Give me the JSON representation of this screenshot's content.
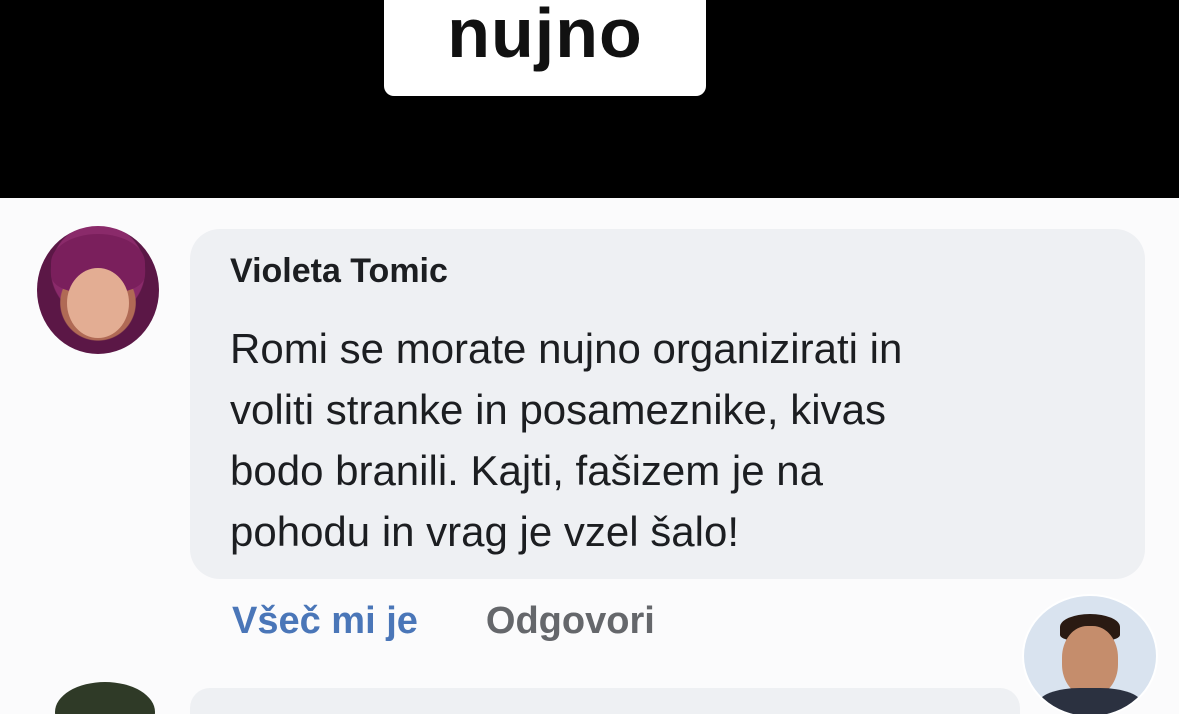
{
  "caption": {
    "text": "nujno"
  },
  "comment": {
    "author": "Violeta Tomic",
    "text": "Romi se morate nujno organizirati in\nvoliti stranke in posameznike, kivas\nbodo branili. Kajti, fašizem je na\npohodu in vrag je vzel šalo!",
    "actions": {
      "like_label": "Všeč mi je",
      "reply_label": "Odgovori"
    }
  },
  "colors": {
    "like_link": "#4a76b8",
    "reply_link": "#65676b",
    "bubble": "#eef0f3",
    "top_band": "#000000"
  }
}
